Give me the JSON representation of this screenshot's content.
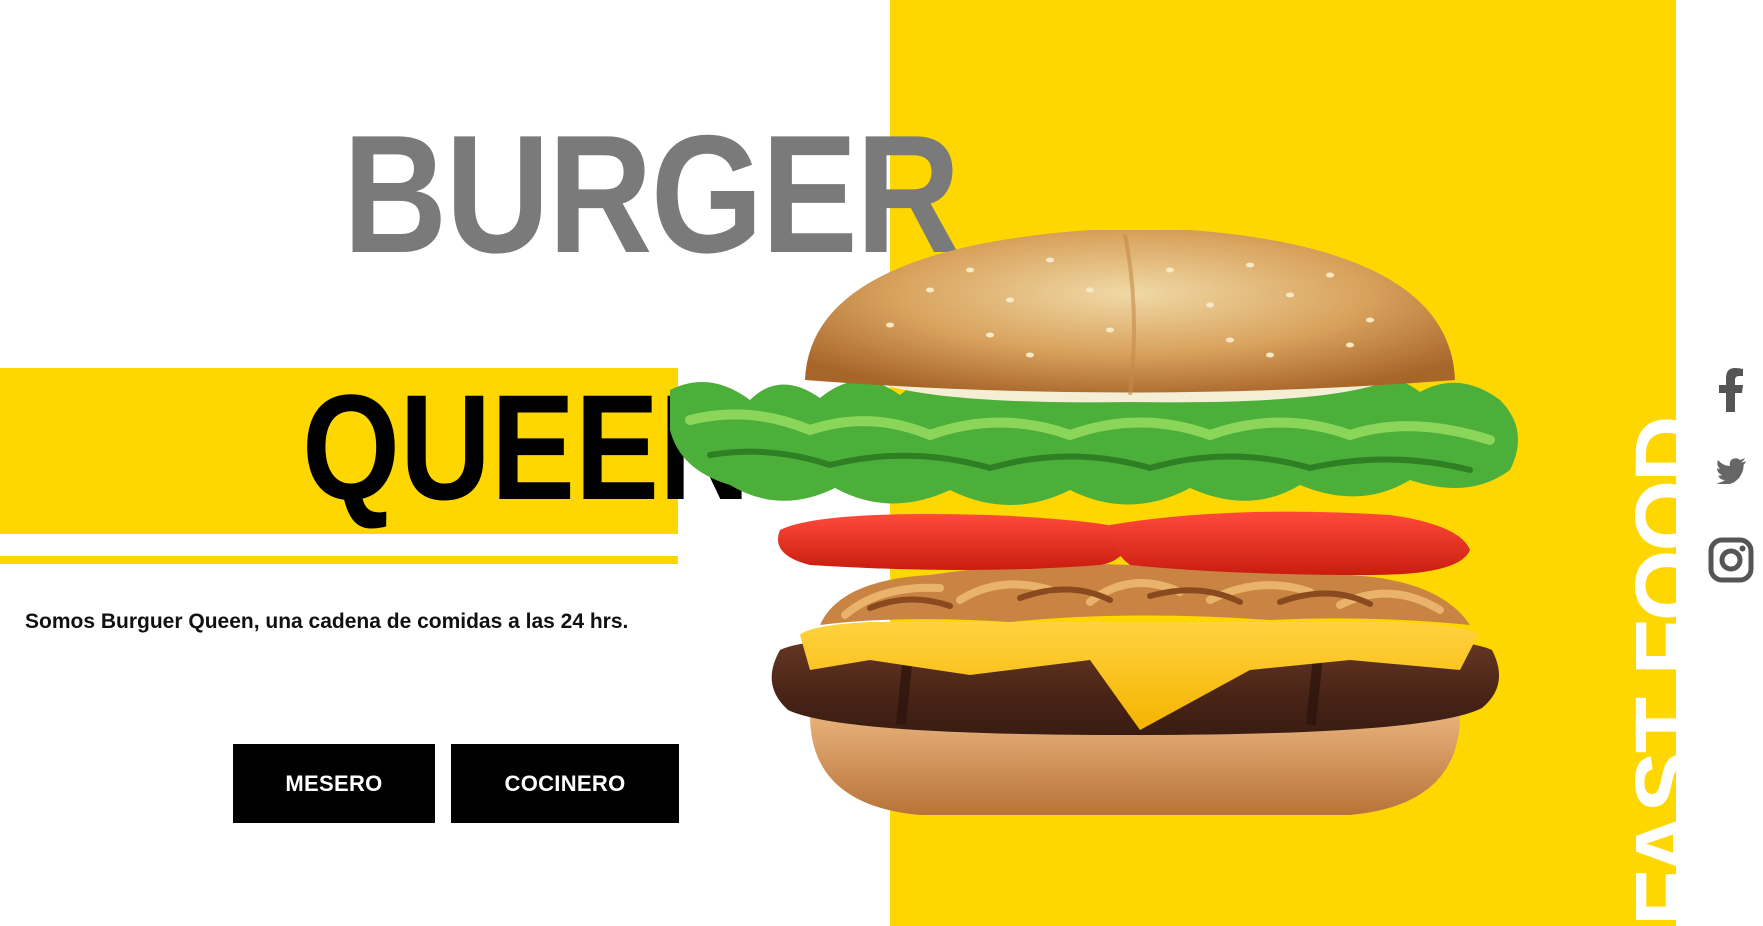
{
  "brand": {
    "line1": "BURGER",
    "line2": "QUEEN"
  },
  "tagline": "Somos Burguer Queen, una cadena de comidas a las 24 hrs.",
  "buttons": {
    "mesero": "MESERO",
    "cocinero": "COCINERO"
  },
  "vertical_banner": "FAST FOOD",
  "social": [
    {
      "name": "facebook-icon"
    },
    {
      "name": "twitter-icon"
    },
    {
      "name": "instagram-icon"
    }
  ],
  "colors": {
    "accent": "#FFD700",
    "title_gray": "#7a7a7a",
    "button_bg": "#000000",
    "icon_gray": "#555555"
  }
}
